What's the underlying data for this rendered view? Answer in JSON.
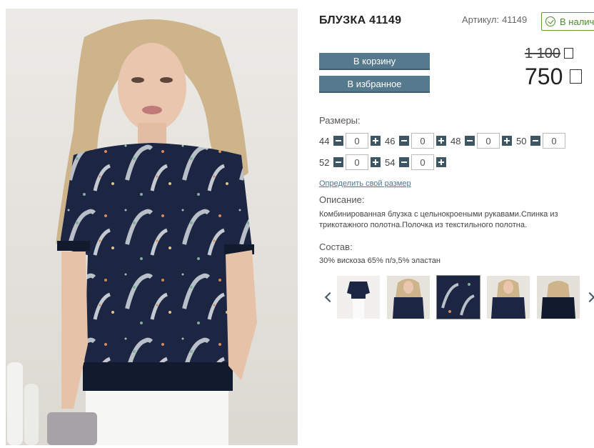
{
  "product": {
    "title": "БЛУЗКА 41149",
    "article_label": "Артикул:",
    "article_value": "41149",
    "stock_label": "В наличии",
    "old_price": "1 100",
    "price": "750"
  },
  "buttons": {
    "cart": "В корзину",
    "favorite": "В избранное"
  },
  "sizes": {
    "label": "Размеры:",
    "items": [
      {
        "size": "44",
        "qty": "0"
      },
      {
        "size": "46",
        "qty": "0"
      },
      {
        "size": "48",
        "qty": "0"
      },
      {
        "size": "50",
        "qty": "0"
      },
      {
        "size": "52",
        "qty": "0"
      },
      {
        "size": "54",
        "qty": "0"
      }
    ],
    "size_link": "Определить свой размер"
  },
  "description": {
    "label": "Описание:",
    "text": "Комбинированная блузка с цельнокроеными рукавами.Спинка из трикотажного полотна.Полочка из текстильного полотна."
  },
  "composition": {
    "label": "Состав:",
    "text": "30% вискоза 65% п/э,5% эластан"
  },
  "colors": {
    "accent_button": "#557a8e",
    "stepper": "#3e5664",
    "stock_green": "#4c8d2e",
    "blouse_navy": "#1c2541"
  },
  "thumbnails": {
    "count": 5,
    "active_index": 2
  }
}
